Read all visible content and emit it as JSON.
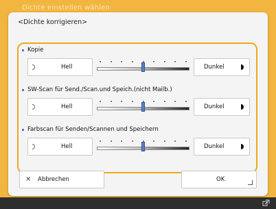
{
  "background_title": "Dichte einstellen wählen",
  "dialog": {
    "title": "<Dichte korrigieren>"
  },
  "sections": [
    {
      "label": "Kopie",
      "light_label": "Hell",
      "dark_label": "Dunkel",
      "level": 0.5
    },
    {
      "label": "SW-Scan für Send./Scan.und Speich.(nicht Mailb.)",
      "light_label": "Hell",
      "dark_label": "Dunkel",
      "level": 0.5
    },
    {
      "label": "Farbscan für Senden/Scannen und Speichern",
      "light_label": "Hell",
      "dark_label": "Dunkel",
      "level": 0.5
    }
  ],
  "buttons": {
    "cancel_label": "Abbrechen",
    "ok_label": "OK"
  },
  "icons": {
    "cancel": "close-icon",
    "status": "network-icon"
  },
  "colors": {
    "accent": "#f0a818",
    "background": "#f2b640",
    "thumb": "#5a7fbf"
  }
}
